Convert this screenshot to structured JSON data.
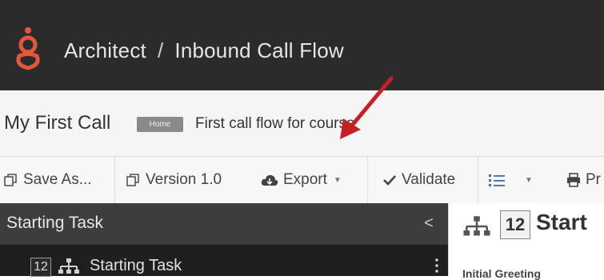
{
  "header": {
    "breadcrumb_root": "Architect",
    "breadcrumb_sep": "/",
    "breadcrumb_current": "Inbound Call Flow",
    "logo_icon": "genesys-logo-icon",
    "logo_color": "#e4573d"
  },
  "flow": {
    "name": "My First Call",
    "badge": "Home",
    "description": "First call flow for course"
  },
  "toolbar": {
    "save_as_label": "Save As...",
    "version_label": "Version 1.0",
    "export_label": "Export",
    "validate_label": "Validate",
    "print_label": "Pr"
  },
  "panel": {
    "title": "Starting Task",
    "collapse_symbol": "<",
    "row_number": "12",
    "row_label": "Starting Task"
  },
  "detail": {
    "number": "12",
    "title": "Start",
    "subtitle": "Initial Greeting"
  },
  "annotation": {
    "arrow_color": "#c62026"
  }
}
